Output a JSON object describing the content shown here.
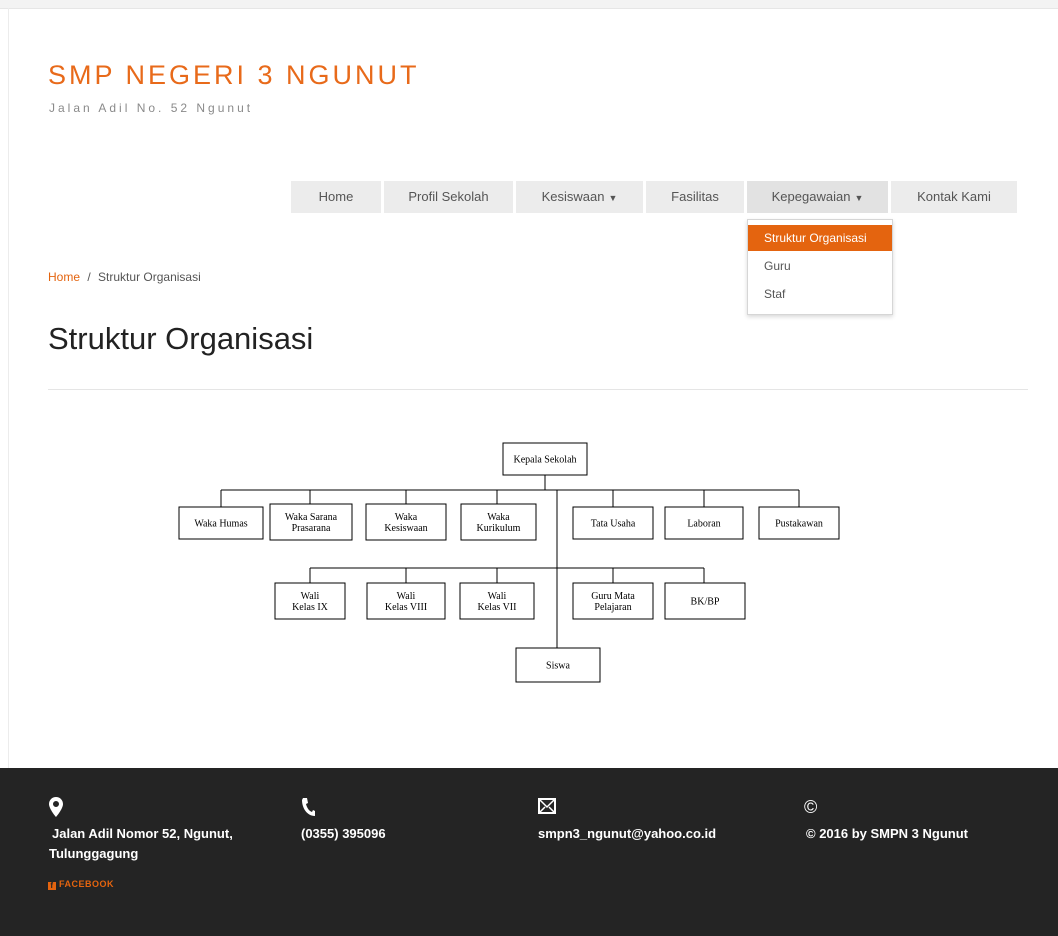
{
  "site": {
    "title": "SMP NEGERI 3 NGUNUT",
    "subtitle": "Jalan Adil No. 52 Ngunut"
  },
  "nav": {
    "items": [
      {
        "label": "Home",
        "dropdown": false
      },
      {
        "label": "Profil Sekolah",
        "dropdown": false
      },
      {
        "label": "Kesiswaan",
        "dropdown": true
      },
      {
        "label": "Fasilitas",
        "dropdown": false
      },
      {
        "label": "Kepegawaian",
        "dropdown": true
      },
      {
        "label": "Kontak Kami",
        "dropdown": false
      }
    ],
    "dropdown_items": [
      "Struktur Organisasi",
      "Guru",
      "Staf"
    ],
    "dropdown_selected": "Struktur Organisasi"
  },
  "breadcrumb": {
    "home": "Home",
    "separator": "/",
    "current": "Struktur Organisasi"
  },
  "page": {
    "title": "Struktur Organisasi"
  },
  "org_chart": {
    "root": "Kepala Sekolah",
    "row1": [
      [
        "Waka Humas"
      ],
      [
        "Waka Sarana",
        "Prasarana"
      ],
      [
        "Waka",
        "Kesiswaan"
      ],
      [
        "Waka",
        "Kurikulum"
      ],
      [
        "Tata Usaha"
      ],
      [
        "Laboran"
      ],
      [
        "Pustakawan"
      ]
    ],
    "row2": [
      [
        "Wali",
        "Kelas IX"
      ],
      [
        "Wali",
        "Kelas VIII"
      ],
      [
        "Wali",
        "Kelas VII"
      ],
      [
        "Guru Mata",
        "Pelajaran"
      ],
      [
        "BK/BP"
      ]
    ],
    "row3": [
      [
        "Siswa"
      ]
    ]
  },
  "footer": {
    "address_line1": "Jalan Adil Nomor 52, Ngunut,",
    "address_line2": "Tulunggagung",
    "phone": "(0355) 395096",
    "email": "smpn3_ngunut@yahoo.co.id",
    "copyright": "© 2016 by SMPN 3 Ngunut",
    "facebook": "FACEBOOK"
  },
  "colors": {
    "accent": "#e4640f",
    "footer_bg": "#242424",
    "nav_bg": "#ececec"
  }
}
